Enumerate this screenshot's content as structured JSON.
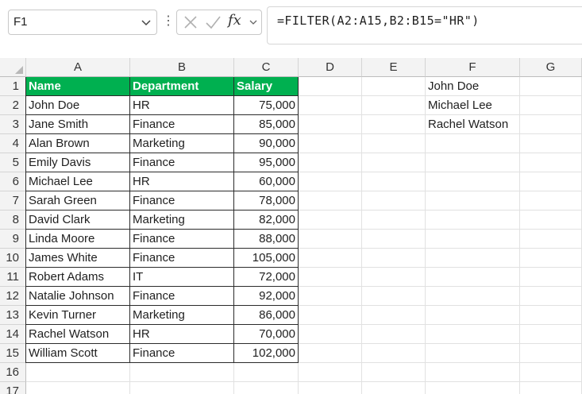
{
  "formula_bar": {
    "name_box": "F1",
    "fx_label": "fx",
    "formula": "=FILTER(A2:A15,B2:B15=\"HR\")"
  },
  "columns": [
    "A",
    "B",
    "C",
    "D",
    "E",
    "F",
    "G"
  ],
  "rows": [
    "1",
    "2",
    "3",
    "4",
    "5",
    "6",
    "7",
    "8",
    "9",
    "10",
    "11",
    "12",
    "13",
    "14",
    "15",
    "16",
    "17"
  ],
  "table": {
    "headers": [
      "Name",
      "Department",
      "Salary"
    ],
    "rows": [
      [
        "John Doe",
        "HR",
        "75,000"
      ],
      [
        "Jane Smith",
        "Finance",
        "85,000"
      ],
      [
        "Alan Brown",
        "Marketing",
        "90,000"
      ],
      [
        "Emily Davis",
        "Finance",
        "95,000"
      ],
      [
        "Michael Lee",
        "HR",
        "60,000"
      ],
      [
        "Sarah Green",
        "Finance",
        "78,000"
      ],
      [
        "David Clark",
        "Marketing",
        "82,000"
      ],
      [
        "Linda Moore",
        "Finance",
        "88,000"
      ],
      [
        "James White",
        "Finance",
        "105,000"
      ],
      [
        "Robert Adams",
        "IT",
        "72,000"
      ],
      [
        "Natalie Johnson",
        "Finance",
        "92,000"
      ],
      [
        "Kevin Turner",
        "Marketing",
        "86,000"
      ],
      [
        "Rachel Watson",
        "HR",
        "70,000"
      ],
      [
        "William Scott",
        "Finance",
        "102,000"
      ]
    ],
    "header_color": "#00b050"
  },
  "filter_results": [
    "John Doe",
    "Michael Lee",
    "Rachel Watson"
  ]
}
